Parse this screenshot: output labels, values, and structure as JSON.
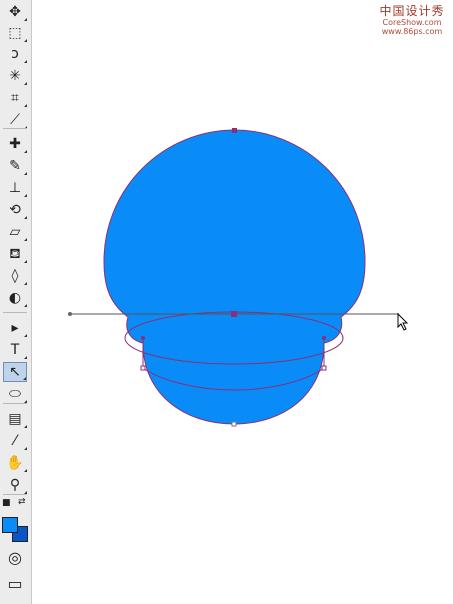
{
  "watermark": {
    "line1": "中国设计秀",
    "line2": "CoreShow.com",
    "line3": "www.86ps.com"
  },
  "colors": {
    "fill": "#0a8cf8",
    "path_stroke": "#8a2f7a",
    "guide_line": "#555555",
    "foreground_swatch": "#0a8cf8",
    "background_swatch": "#0a55c8"
  },
  "toolbar": {
    "tools": [
      {
        "icon": "move-icon",
        "glyph": "✥"
      },
      {
        "icon": "marquee-icon",
        "glyph": "⬚"
      },
      {
        "icon": "lasso-icon",
        "glyph": "ↄ"
      },
      {
        "icon": "magic-wand-icon",
        "glyph": "✳"
      },
      {
        "icon": "crop-icon",
        "glyph": "⌗"
      },
      {
        "icon": "slice-icon",
        "glyph": "⟋"
      },
      {
        "icon": "healing-brush-icon",
        "glyph": "✚"
      },
      {
        "icon": "brush-icon",
        "glyph": "✎"
      },
      {
        "icon": "clone-stamp-icon",
        "glyph": "⊥"
      },
      {
        "icon": "history-brush-icon",
        "glyph": "⟲"
      },
      {
        "icon": "eraser-icon",
        "glyph": "▱"
      },
      {
        "icon": "paint-bucket-icon",
        "glyph": "⛾"
      },
      {
        "icon": "blur-icon",
        "glyph": "◊"
      },
      {
        "icon": "dodge-icon",
        "glyph": "◐"
      },
      {
        "icon": "path-selection-icon",
        "glyph": "▸"
      },
      {
        "icon": "type-icon",
        "glyph": "T"
      },
      {
        "icon": "direct-selection-icon",
        "glyph": "↖"
      },
      {
        "icon": "ellipse-tool-icon",
        "glyph": "⬭"
      },
      {
        "icon": "notes-icon",
        "glyph": "▤"
      },
      {
        "icon": "eyedropper-icon",
        "glyph": "⁄"
      },
      {
        "icon": "hand-icon",
        "glyph": "✋"
      },
      {
        "icon": "zoom-icon",
        "glyph": "⚲"
      }
    ],
    "active_tool": "direct-selection-icon",
    "swap_glyph": "⇄",
    "default_colors_glyph": "■",
    "quick_mask_glyph": "◎",
    "screen_mode_glyph": "▭"
  }
}
